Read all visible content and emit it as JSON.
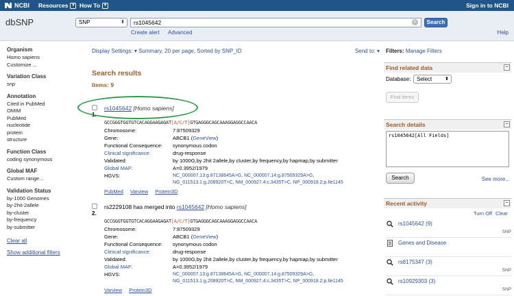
{
  "topbar": {
    "logo": "NCBI",
    "resources": "Resources",
    "howto": "How To",
    "signin": "Sign in to NCBI"
  },
  "header": {
    "db_title": "dbSNP",
    "db_select": "SNP",
    "search_value": "rs1045642",
    "search_button": "Search",
    "create_alert": "Create alert",
    "advanced": "Advanced",
    "help": "Help"
  },
  "sidebar": {
    "groups": [
      {
        "head": "Organism",
        "items": [
          "Homo sapiens",
          "Customize ..."
        ]
      },
      {
        "head": "Variation Class",
        "items": [
          "snp"
        ]
      },
      {
        "head": "Annotation",
        "items": [
          "Cited in PubMed",
          "OMIM",
          "PubMed",
          "nucleotide",
          "protein",
          "structure"
        ]
      },
      {
        "head": "Function Class",
        "items": [
          "coding synonymous"
        ]
      },
      {
        "head": "Global MAF",
        "items": [
          "Custom range..."
        ]
      },
      {
        "head": "Validation Status",
        "items": [
          "by-1000 Genomes",
          "by-2hit-2allele",
          "by-cluster",
          "by-frequency",
          "by-submitter"
        ]
      }
    ],
    "clear_all": "Clear all",
    "show_filters": "Show additional filters"
  },
  "main": {
    "display_settings_label": "Display Settings:",
    "display_settings_value": "Summary, 20 per page, Sorted by SNP_ID",
    "send_to": "Send to:",
    "results_title": "Search results",
    "items_count": "Items: 9",
    "results": [
      {
        "num": "1.",
        "title_link": "rs1045642",
        "title_prefix": "",
        "title_species": "[Homo sapiens]",
        "seq_left": "GCCGGGTGGTGTCACAGGAAGAGAT",
        "seq_allele": "[A/C/T]",
        "seq_right": "GTGAGGGCAGCAAAGGAGGCCAACA",
        "fields": {
          "chromosome_k": "Chromosome:",
          "chromosome_v": "7:87509329",
          "gene_k": "Gene:",
          "gene_v": "ABCB1",
          "gene_link": "GeneView",
          "func_k": "Functional Consequence:",
          "func_v": "synonymous codon",
          "clin_k": "Clinical significance:",
          "clin_v": "drug-response",
          "valid_k": "Validated:",
          "valid_v": "by 1000G,by 2hit 2allele,by cluster,by frequency,by hapmap,by submitter",
          "maf_k": "Global MAF:",
          "maf_v": "A=0.3952/1979",
          "hgvs_k": "HGVS:",
          "hgvs_1": "NC_000007.13:g.87138645A>G, NC_000007.14:g.87509329A>G,",
          "hgvs_2": "NG_011513.1:g.208920T>C, NM_000927.4:c.3435T>C, NP_000918.2:p.Ile1145"
        },
        "links": [
          "PubMed",
          "Varview",
          "Protein3D"
        ]
      },
      {
        "num": "2.",
        "title_prefix": "rs2229108 has merged into",
        "title_link": "rs1045642",
        "title_species": "[Homo sapiens]",
        "seq_left": "GCCGGGTGGTGTCACAGGAAGAGAT",
        "seq_allele": "[A/C/T]",
        "seq_right": "GTGAGGGCAGCAAAGGAGGCCAACA",
        "fields": {
          "chromosome_k": "Chromosome:",
          "chromosome_v": "7:87509329",
          "gene_k": "Gene:",
          "gene_v": "ABCB1",
          "gene_link": "GeneView",
          "func_k": "Functional Consequence:",
          "func_v": "synonymous codon",
          "clin_k": "Clinical significance:",
          "clin_v": "drug-response",
          "valid_k": "Validated:",
          "valid_v": "by 1000G,by 2hit 2allele,by cluster,by frequency,by hapmap,by submitter",
          "maf_k": "Global MAF:",
          "maf_v": "A=0.3952/1979",
          "hgvs_k": "HGVS:",
          "hgvs_1": "NC_000007.13:g.87138645A>G, NC_000007.14:g.87509329A>G,",
          "hgvs_2": "NG_011513.1:g.208920T>C, NM_000927.4:c.3435T>C, NP_000918.2:p.Ile1145"
        },
        "links": [
          "Varview",
          "Protein3D"
        ]
      }
    ]
  },
  "rpanel": {
    "filters_label": "Filters:",
    "manage_filters": "Manage Filters",
    "find_related": "Find related data",
    "database_label": "Database:",
    "database_select": "Select",
    "find_items": "Find items",
    "search_details": "Search details",
    "details_text": "rs1045642[All Fields]",
    "details_search": "Search",
    "see_more": "See more...",
    "recent_activity": "Recent activity",
    "turn_off": "Turn Off",
    "clear": "Clear",
    "activity": [
      {
        "label": "rs1045642 (9)",
        "db": "SNP",
        "icon": "search-icon"
      },
      {
        "label": "Genes and Disease",
        "db": "",
        "icon": "book-icon"
      },
      {
        "label": "rs8175347 (3)",
        "db": "SNP",
        "icon": "search-icon"
      },
      {
        "label": "rs10929303 (3)",
        "db": "SNP",
        "icon": "search-icon"
      }
    ]
  },
  "colors": {
    "topbar": "#20558a",
    "section_heading": "#995d28",
    "link": "#2b4f9e",
    "highlight": "#2d9b4a",
    "allele": "#c8502b"
  }
}
